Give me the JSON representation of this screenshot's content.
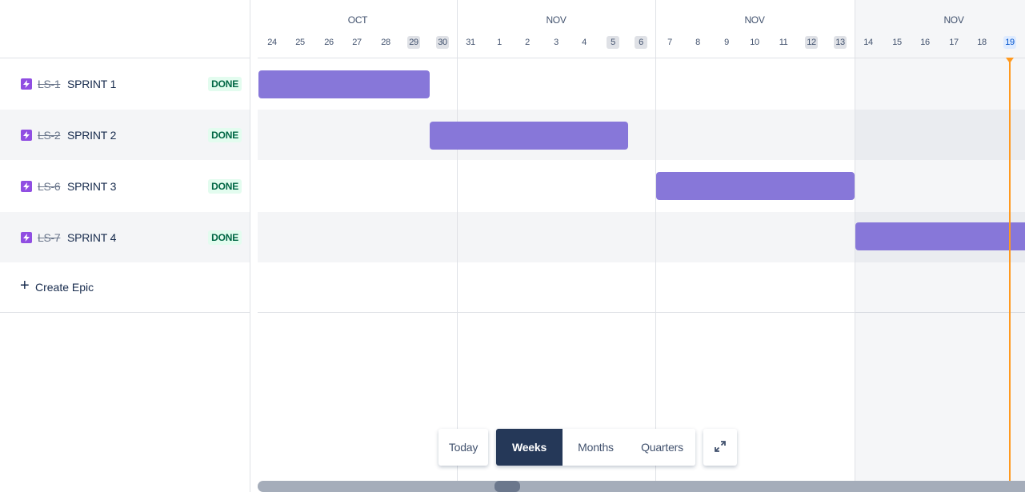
{
  "epics": [
    {
      "key": "LS-1",
      "title": "SPRINT 1",
      "status": "DONE",
      "icon": "epic-lightning-icon"
    },
    {
      "key": "LS-2",
      "title": "SPRINT 2",
      "status": "DONE",
      "icon": "epic-lightning-icon"
    },
    {
      "key": "LS-6",
      "title": "SPRINT 3",
      "status": "DONE",
      "icon": "epic-lightning-icon"
    },
    {
      "key": "LS-7",
      "title": "SPRINT 4",
      "status": "DONE",
      "icon": "epic-lightning-icon"
    }
  ],
  "create_epic": {
    "label": "Create Epic",
    "icon": "plus-icon"
  },
  "timeline": {
    "months": [
      "OCT",
      "NOV",
      "NOV",
      "NOV"
    ],
    "days": [
      "24",
      "25",
      "26",
      "27",
      "28",
      "29",
      "30",
      "31",
      "1",
      "2",
      "3",
      "4",
      "5",
      "6",
      "7",
      "8",
      "9",
      "10",
      "11",
      "12",
      "13",
      "14",
      "15",
      "16",
      "17",
      "18",
      "19"
    ],
    "weekend_days": [
      "29",
      "30",
      "5",
      "6",
      "12",
      "13"
    ],
    "today": "19"
  },
  "controls": {
    "today": "Today",
    "weeks": "Weeks",
    "months": "Months",
    "quarters": "Quarters",
    "expand_icon": "expand-arrows-icon",
    "active_scale": "Weeks"
  },
  "colors": {
    "epic_icon": "#904ee2",
    "bar": "#8777d9",
    "status_text": "#006644",
    "status_bg": "#e3fcef",
    "today_line": "#ff991f",
    "active_control": "#253858"
  }
}
